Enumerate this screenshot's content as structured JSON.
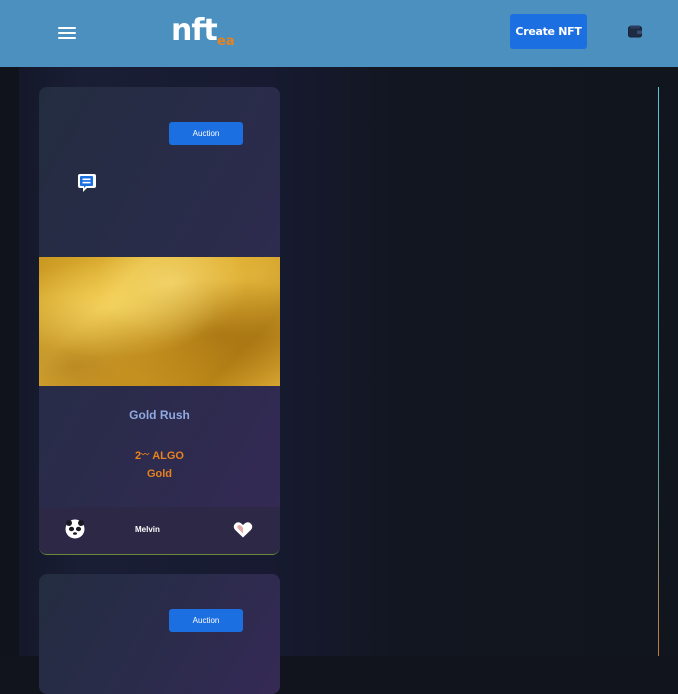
{
  "header": {
    "logo_text": "nft",
    "logo_sub": "ea",
    "create_button_label": "Create NFT",
    "menu_icon": "hamburger-menu-icon",
    "wallet_icon": "wallet-icon",
    "background_color": "#4b90bf"
  },
  "cards": [
    {
      "badge_label": "Auction",
      "chat_icon": "chat-bubble-icon",
      "title": "Gold Rush",
      "price_amount": "2",
      "price_currency": "ALGO",
      "price_icon": "algo-icon",
      "type_label": "Gold",
      "owner_name": "Melvin",
      "avatar_icon": "panda-avatar-icon",
      "like_icon": "heart-icon"
    },
    {
      "badge_label": "Auction"
    }
  ],
  "colors": {
    "accent_blue": "#1b6fe0",
    "accent_orange": "#e8821e",
    "title_blue": "#8fa8e0"
  }
}
